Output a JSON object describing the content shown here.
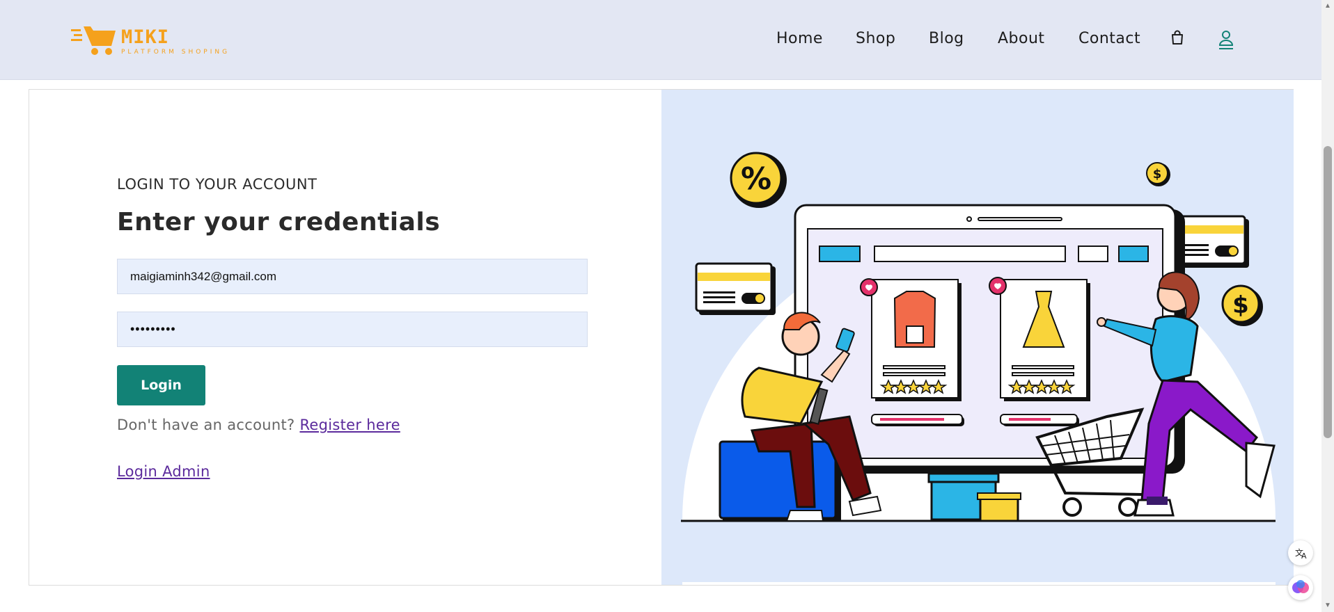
{
  "header": {
    "logo": {
      "name": "MIKI",
      "tagline": "PLATFORM SHOPING"
    },
    "nav": [
      {
        "label": "Home"
      },
      {
        "label": "Shop"
      },
      {
        "label": "Blog"
      },
      {
        "label": "About"
      },
      {
        "label": "Contact"
      }
    ],
    "icons": [
      "shopping-bag-icon",
      "user-icon"
    ]
  },
  "login": {
    "eyebrow": "LOGIN TO YOUR ACCOUNT",
    "heading": "Enter your credentials",
    "email_value": "maigiaminh342@gmail.com",
    "password_value": "•••••••••",
    "button_label": "Login",
    "register_prompt": "Don't have an account?",
    "register_link": "Register here",
    "admin_link": "Login Admin"
  },
  "colors": {
    "header_bg": "#e3e7f3",
    "accent": "#128276",
    "link": "#5b2a9c",
    "logo": "#f5a11c",
    "illustration_bg": "#dde8fa"
  },
  "floating": [
    "translate-icon",
    "ai-assistant-icon"
  ]
}
